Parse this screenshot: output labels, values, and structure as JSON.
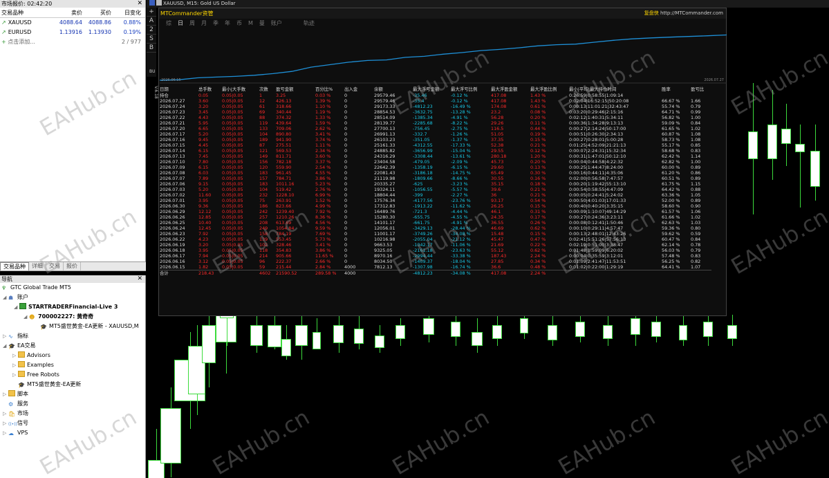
{
  "market_watch": {
    "title": "市场报价: 02:42:20",
    "headers": [
      "交易品种",
      "卖价",
      "买价",
      "日变化"
    ],
    "rows": [
      {
        "symbol": "XAUUSD",
        "bid": "4088.64",
        "ask": "4088.86",
        "change": "0.88%"
      },
      {
        "symbol": "EURUSD",
        "bid": "1.13916",
        "ask": "1.13930",
        "change": "0.19%"
      }
    ],
    "add_label": "点击添加...",
    "count": "2 / 977",
    "tabs": [
      "交易品种",
      "详细",
      "交易",
      "报价"
    ]
  },
  "navigator": {
    "title": "导航",
    "broker": "GTC Global Trade MT5",
    "accounts": "账户",
    "server": "STARTRADERFinancial-Live 3",
    "account": "700002227: 黄奇奇",
    "ea_instance": "MT5盛世黄金-EA更新 - XAUUSD,M",
    "indicators": "指标",
    "ea": "EA交易",
    "folders": [
      "Advisors",
      "Examples",
      "Free Robots"
    ],
    "ea_file": "MT5盛世黄金-EA更新",
    "scripts": "脚本",
    "services": "服务",
    "market": "市场",
    "signals": "信号",
    "vps": "VPS"
  },
  "chart": {
    "title_bar": "XAUUSD, M15:  Gold US Dollar",
    "side_tools": [
      "+",
      "A",
      "2",
      "S",
      "B"
    ]
  },
  "report": {
    "title": "MTCommander资管",
    "brand_prefix": "复盘侠",
    "brand_url": "http://MTCommander.com",
    "menu": [
      "综",
      "日",
      "周",
      "月",
      "季",
      "年",
      "币",
      "M",
      "曼",
      "账户",
      "轨迹"
    ],
    "equity_start": "2026.06.15",
    "equity_end": "2026.07.27",
    "side_labels": [
      "BU",
      "V.6.18"
    ],
    "headers": [
      "日期",
      "总手数",
      "最小|大手数",
      "次数",
      "盈亏金额",
      "百分比%",
      "出入金",
      "余额",
      "最大浮亏金额",
      "最大浮亏比例",
      "最大浮盈金额",
      "最大浮盈比例",
      "最小|平均|最大持仓时间",
      "胜率",
      "盈亏比"
    ],
    "rows": [
      [
        "持仓",
        "0.05",
        "0.05|0.05",
        "1",
        "3.25",
        "0.03 %",
        "0",
        "29579.46",
        "-35.46",
        "-0.12 %",
        "417.08",
        "1.43 %",
        "0:26:59|0:58:55|1:09:14",
        "",
        ""
      ],
      [
        "2026.07.27",
        "3.60",
        "0.05|0.05",
        "12",
        "426.13",
        "1.39 %",
        "0",
        "29579.46",
        "-35.4",
        "-0.12 %",
        "417.08",
        "1.43 %",
        "0:02:04|16:52:15|50:20:08",
        "66.67 %",
        "1.66"
      ],
      [
        "2026.07.24",
        "3.20",
        "0.05|0.05",
        "61",
        "318.66",
        "1.10 %",
        "0",
        "29173.33",
        "-4812.23",
        "-16.49 %",
        "174.08",
        "0.61 %",
        "0:00:13|11:01:21|32:43:47",
        "55.74 %",
        "0.79"
      ],
      [
        "2026.07.23",
        "3.45",
        "0.05|0.05",
        "69",
        "340.44",
        "1.19 %",
        "0",
        "28854.53",
        "-3632.75",
        "-13.28 %",
        "23.2",
        "0.08 %",
        "0:03:20|0:29:46|2:15:16",
        "64.71 %",
        "0.99"
      ],
      [
        "2026.07.22",
        "4.43",
        "0.05|0.05",
        "88",
        "374.32",
        "1.33 %",
        "0",
        "28514.09",
        "-1385.34",
        "-4.91 %",
        "56.28",
        "0.20 %",
        "0:02:12|1:40:31|5:34:11",
        "56.82 %",
        "1.00"
      ],
      [
        "2026.07.21",
        "5.95",
        "0.05|0.05",
        "119",
        "439.64",
        "1.59 %",
        "0",
        "28139.77",
        "-2285.68",
        "-8.22 %",
        "29.26",
        "0.11 %",
        "0:00:36|1:34:28|9:13:13",
        "59.09 %",
        "0.84"
      ],
      [
        "2026.07.20",
        "6.65",
        "0.05|0.05",
        "133",
        "709.06",
        "2.62 %",
        "0",
        "27700.13",
        "-756.45",
        "-2.75 %",
        "116.5",
        "0.44 %",
        "0:00:27|2:14:24|50:17:00",
        "61.65 %",
        "1.02"
      ],
      [
        "2026.07.17",
        "5.20",
        "0.05|0.05",
        "104",
        "890.80",
        "3.41 %",
        "0",
        "26991.13",
        "-332.7",
        "-1.26 %",
        "51.05",
        "0.19 %",
        "0:00:51|0:26:30|2:34:13",
        "60.87 %",
        "1.08"
      ],
      [
        "2026.07.16",
        "9.45",
        "0.05|0.05",
        "189",
        "941.90",
        "3.74 %",
        "0",
        "26103.23",
        "-351.05",
        "-1.37 %",
        "37.35",
        "0.15 %",
        "0:00:27|0:28:01|5:00:28",
        "58.73 %",
        "1.08"
      ],
      [
        "2026.07.15",
        "4.45",
        "0.05|0.05",
        "87",
        "275.51",
        "1.11 %",
        "0",
        "25161.33",
        "-4312.55",
        "-17.33 %",
        "52.38",
        "0.21 %",
        "0:01:25|4:52:09|21:21:13",
        "55.17 %",
        "0.85"
      ],
      [
        "2026.07.14",
        "6.15",
        "0.05|0.05",
        "121",
        "569.53",
        "2.34 %",
        "0",
        "24885.82",
        "-3656.99",
        "-15.04 %",
        "29.55",
        "0.12 %",
        "0:00:07|2:24:31|15:32:34",
        "58.68 %",
        "0.83"
      ],
      [
        "2026.07.13",
        "7.45",
        "0.05|0.05",
        "149",
        "811.71",
        "3.60 %",
        "0",
        "24316.29",
        "-3308.44",
        "-13.61 %",
        "280.18",
        "1.20 %",
        "0:00:31|1:47:01|50:12:10",
        "62.42 %",
        "1.14"
      ],
      [
        "2026.07.10",
        "7.80",
        "0.05|0.05",
        "156",
        "782.18",
        "3.37 %",
        "0",
        "23404.58",
        "-479.05",
        "-2.09 %",
        "45.73",
        "0.20 %",
        "0:00:04|0:44:58|4:22:32",
        "62.82 %",
        "1.00"
      ],
      [
        "2026.07.09",
        "6.15",
        "0.05|0.05",
        "120",
        "559.90",
        "2.54 %",
        "0",
        "22642.39",
        "-1358.19",
        "-6.15 %",
        "29.60",
        "0.13 %",
        "0:00:25|1:44:47|8:24:00",
        "60.00 %",
        "0.89"
      ],
      [
        "2026.07.08",
        "6.03",
        "0.05|0.05",
        "183",
        "961.45",
        "4.55 %",
        "0",
        "22081.43",
        "-3186.18",
        "-14.75 %",
        "65.49",
        "0.30 %",
        "0:00:16|0:44:11|4:35:06",
        "61.20 %",
        "0.86"
      ],
      [
        "2026.07.07",
        "7.89",
        "0.05|0.05",
        "157",
        "784.71",
        "3.86 %",
        "0",
        "21119.98",
        "-1809.66",
        "-8.66 %",
        "30.55",
        "0.16 %",
        "0:02:00|0:56:58|7:47:57",
        "60.51 %",
        "0.89"
      ],
      [
        "2026.07.06",
        "9.15",
        "0.05|0.05",
        "183",
        "1011.16",
        "5.23 %",
        "0",
        "20335.27",
        "-625",
        "-3.23 %",
        "35.15",
        "0.18 %",
        "0:00:20|1:19:42|55:13:10",
        "61.75 %",
        "1.15"
      ],
      [
        "2026.07.03",
        "5.20",
        "0.05|0.05",
        "104",
        "519.42",
        "2.76 %",
        "0",
        "19324.11",
        "-1056.55",
        "-5.57 %",
        "39.6",
        "0.21 %",
        "0:00:54|0:58:55|4:47:09",
        "64.42 %",
        "0.88"
      ],
      [
        "2026.07.02",
        "11.60",
        "0.05|0.05",
        "232",
        "1228.10",
        "6.99 %",
        "0",
        "18804.44",
        "-399",
        "-2.27 %",
        "36",
        "0.21 %",
        "0:00:05|0:24:41|5:24:02",
        "63.36 %",
        "1.05"
      ],
      [
        "2026.07.01",
        "3.95",
        "0.05|0.05",
        "75",
        "263.91",
        "1.52 %",
        "0",
        "17576.34",
        "-4177.56",
        "-23.76 %",
        "93.17",
        "0.54 %",
        "0:00:50|4:01:03|17:01:33",
        "52.00 %",
        "0.89"
      ],
      [
        "2026.06.30",
        "9.36",
        "0.05|0.05",
        "186",
        "823.66",
        "4.99 %",
        "0",
        "17312.83",
        "-1913.22",
        "-11.62 %",
        "26.25",
        "0.15 %",
        "0:00:40|0:40:20|3:35:15",
        "58.60 %",
        "0.90"
      ],
      [
        "2026.06.29",
        "12.12",
        "0.05|0.05",
        "242",
        "1239.40",
        "7.92 %",
        "0",
        "16489.76",
        "-721.3",
        "-4.44 %",
        "46.1",
        "0.31 %",
        "0:00:09|1:10:07|49:14:29",
        "61.57 %",
        "1.06"
      ],
      [
        "2026.06.26",
        "12.85",
        "0.05|0.05",
        "257",
        "1210.26",
        "8.36 %",
        "0",
        "15280.30",
        "-655.75",
        "-4.55 %",
        "24.35",
        "0.17 %",
        "0:00:27|0:24:36|3:23:11",
        "61.66 %",
        "1.02"
      ],
      [
        "2026.06.25",
        "10.40",
        "0.05|0.05",
        "208",
        "613.69",
        "4.56 %",
        "0",
        "14101.17",
        "-661.75",
        "-4.91 %",
        "36.55",
        "0.26 %",
        "0:00:08|0:12:41|1:50:46",
        "62.63 %",
        "1.03"
      ],
      [
        "2026.06.24",
        "12.45",
        "0.05|0.05",
        "249",
        "1054.84",
        "9.59 %",
        "0",
        "12056.01",
        "-3429.13",
        "-28.44 %",
        "46.69",
        "0.62 %",
        "0:00:10|0:29:11|4:57:47",
        "59.36 %",
        "0.80"
      ],
      [
        "2026.06.23",
        "7.92",
        "0.05|0.05",
        "158",
        "784.19",
        "7.69 %",
        "0",
        "11001.17",
        "-3749.26",
        "-34.08 %",
        "15.48",
        "0.15 %",
        "0:00:13|2:48:01|12:43:26",
        "59.62 %",
        "0.59"
      ],
      [
        "2026.06.22",
        "4.23",
        "0.05|0.05",
        "139",
        "553.45",
        "5.73 %",
        "0",
        "10216.98",
        "-2055.04",
        "-21.12 %",
        "45.47",
        "0.47 %",
        "0:02:41|5:51:26|57:56:13",
        "60.47 %",
        "0.84"
      ],
      [
        "2026.06.19",
        "3.20",
        "0.05|0.05",
        "102",
        "328.46",
        "3.41 %",
        "0",
        "9663.53",
        "-1042.17",
        "-11.06 %",
        "21.69",
        "0.22 %",
        "0:02:19|0:51:00|3:38:47",
        "62.14 %",
        "0.78"
      ],
      [
        "2026.06.18",
        "3.95",
        "0.05|0.05",
        "118",
        "354.83",
        "3.86 %",
        "0",
        "9325.05",
        "-2161.18",
        "-23.63 %",
        "55.12",
        "0.62 %",
        "0:01:48|1:59:09|6:20:02",
        "56.03 %",
        "0.79"
      ],
      [
        "2026.06.17",
        "7.94",
        "0.05|0.05",
        "214",
        "905.66",
        "11.65 %",
        "0",
        "8970.16",
        "-2994.44",
        "-33.38 %",
        "187.43",
        "2.24 %",
        "0:00:04|0:35:59|3:12:01",
        "57.48 %",
        "0.83"
      ],
      [
        "2026.06.16",
        "3.12",
        "0.05|0.05",
        "96",
        "222.37",
        "2.66 %",
        "0",
        "8034.50",
        "-1409.37",
        "-18.04 %",
        "27.85",
        "0.34 %",
        "0:01:09|2:41:47|11:53:51",
        "56.25 %",
        "0.82"
      ],
      [
        "2026.06.15",
        "1.82",
        "0.05|0.05",
        "59",
        "215.44",
        "2.84 %",
        "4000",
        "7812.13",
        "-1307.98",
        "-16.74 %",
        "36.6",
        "0.48 %",
        "0:01:02|0:22:00|1:29:19",
        "64.41 %",
        "1.07"
      ]
    ],
    "total": [
      "合计",
      "218.43",
      "",
      "4602",
      "21590.52",
      "289.58 %",
      "4000",
      "",
      "-4812.23",
      "-34.08 %",
      "417.08",
      "2.24 %",
      "",
      "",
      ""
    ]
  },
  "watermark": "EAHub.cn",
  "colors": {
    "loss": "#ff2a2a",
    "float": "#19c8e6",
    "equity_line": "#1e90d8",
    "candle_up": "#ffffff",
    "candle_wick": "#3cdc3c",
    "title_accent": "#ffd700"
  }
}
